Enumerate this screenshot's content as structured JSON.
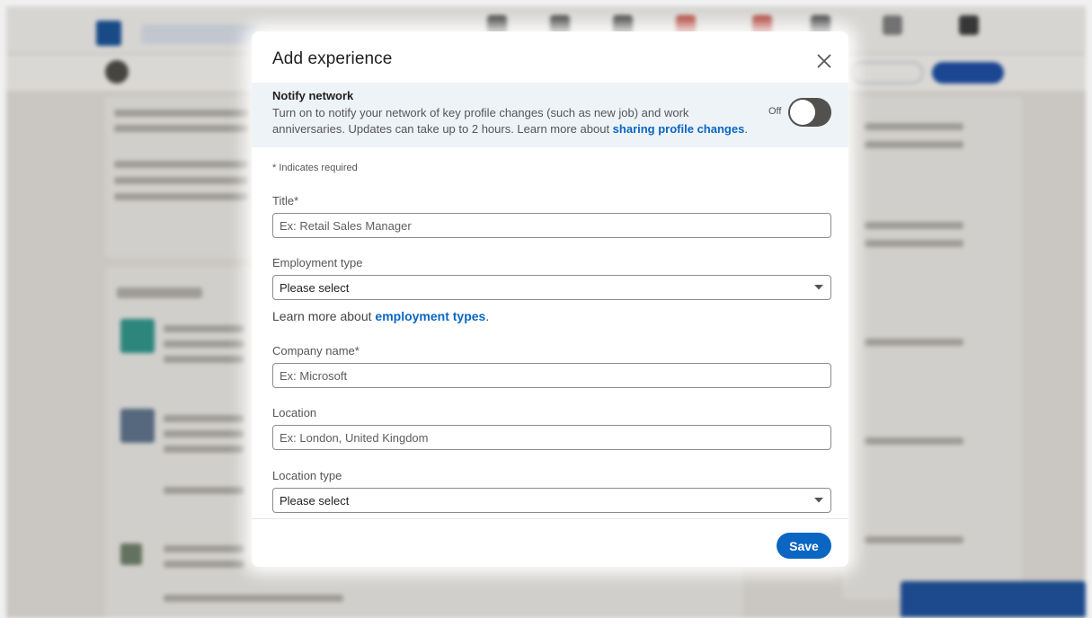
{
  "modal": {
    "title": "Add experience",
    "close_icon": "close-icon",
    "notify": {
      "title": "Notify network",
      "description": "Turn on to notify your network of key profile changes (such as new job) and work anniversaries. Updates can take up to 2 hours. Learn more about ",
      "link_text": "sharing profile changes",
      "link_suffix": ".",
      "toggle_label": "Off",
      "toggle_on": false
    },
    "required_note": "* Indicates required",
    "fields": {
      "title": {
        "label": "Title*",
        "placeholder": "Ex: Retail Sales Manager",
        "value": ""
      },
      "employment_type": {
        "label": "Employment type",
        "value": "Please select"
      },
      "employment_help": {
        "prefix": "Learn more about ",
        "link_text": "employment types",
        "suffix": "."
      },
      "company_name": {
        "label": "Company name*",
        "placeholder": "Ex: Microsoft",
        "value": ""
      },
      "location": {
        "label": "Location",
        "placeholder": "Ex: London, United Kingdom",
        "value": ""
      },
      "location_type": {
        "label": "Location type",
        "value": "Please select"
      }
    },
    "save_label": "Save"
  },
  "colors": {
    "accent": "#0a66c2",
    "notify_background": "#eef3f8",
    "toggle_off": "#52514e"
  }
}
